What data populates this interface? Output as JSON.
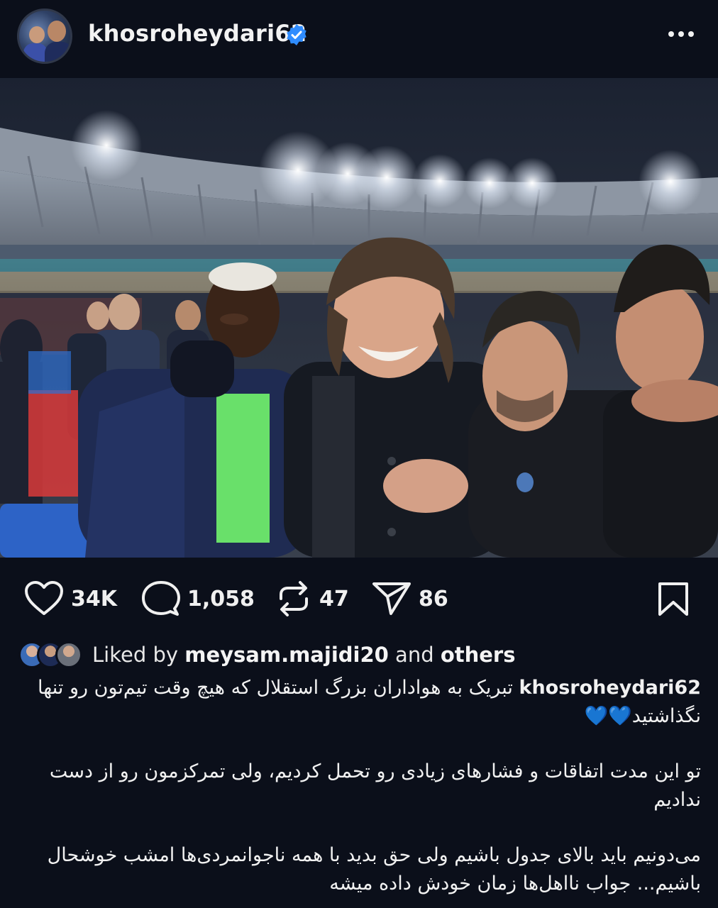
{
  "post": {
    "username": "khosroheydari62",
    "verified_icon": "verified-badge-icon",
    "more_icon": "more-options-icon"
  },
  "colors": {
    "background": "#0b0f1a",
    "verified_blue": "#2f8cff",
    "heart_blue": "#2f8cff"
  },
  "actions": {
    "likes": "34K",
    "comments": "1,058",
    "reposts": "47",
    "shares": "86"
  },
  "liked_by": {
    "prefix": "Liked by",
    "user": "meysam.majidi20",
    "and": "and",
    "others": "others"
  },
  "caption": {
    "username": "khosroheydari62",
    "line1": "تبریک به هواداران بزرگ استقلال که هیچ وقت تیم‌تون رو تنها نگذاشتید",
    "hearts": "💙💙",
    "para2": "تو این مدت اتفاقات و فشارهای زیادی رو تحمل کردیم، ولی تمرکزمون رو از دست ندادیم",
    "para3": "می‌دونیم باید بالای جدول باشیم ولی حق بدید با همه ناجوانمردی‌ها امشب خوشحال باشیم... جواب نااهل‌ها زمان خودش داده میشه"
  }
}
